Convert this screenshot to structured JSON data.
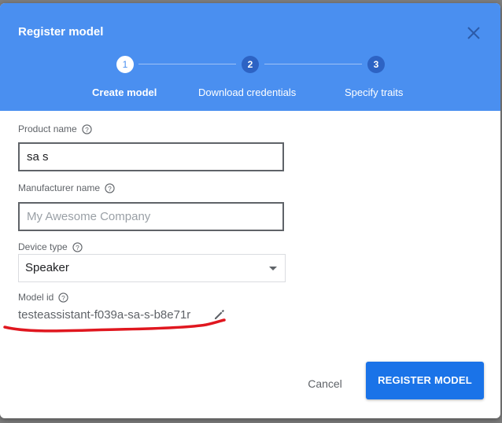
{
  "dialog": {
    "title": "Register model"
  },
  "steps": [
    {
      "number": "1",
      "label": "Create model",
      "active": true
    },
    {
      "number": "2",
      "label": "Download credentials",
      "active": false
    },
    {
      "number": "3",
      "label": "Specify traits",
      "active": false
    }
  ],
  "form": {
    "product_name": {
      "label": "Product name",
      "value": "sa s"
    },
    "manufacturer_name": {
      "label": "Manufacturer name",
      "value": "",
      "placeholder": "My Awesome Company"
    },
    "device_type": {
      "label": "Device type",
      "value": "Speaker"
    },
    "model_id": {
      "label": "Model id",
      "value": "testeassistant-f039a-sa-s-b8e71r"
    }
  },
  "actions": {
    "cancel_label": "Cancel",
    "register_label": "REGISTER MODEL"
  },
  "colors": {
    "header": "#4a8ff0",
    "primary_button": "#1a73e8",
    "annotation": "#e0171f"
  },
  "icons": {
    "close": "close-icon",
    "help": "help-circle-icon",
    "edit": "pencil-icon",
    "dropdown": "dropdown-arrow-icon"
  }
}
